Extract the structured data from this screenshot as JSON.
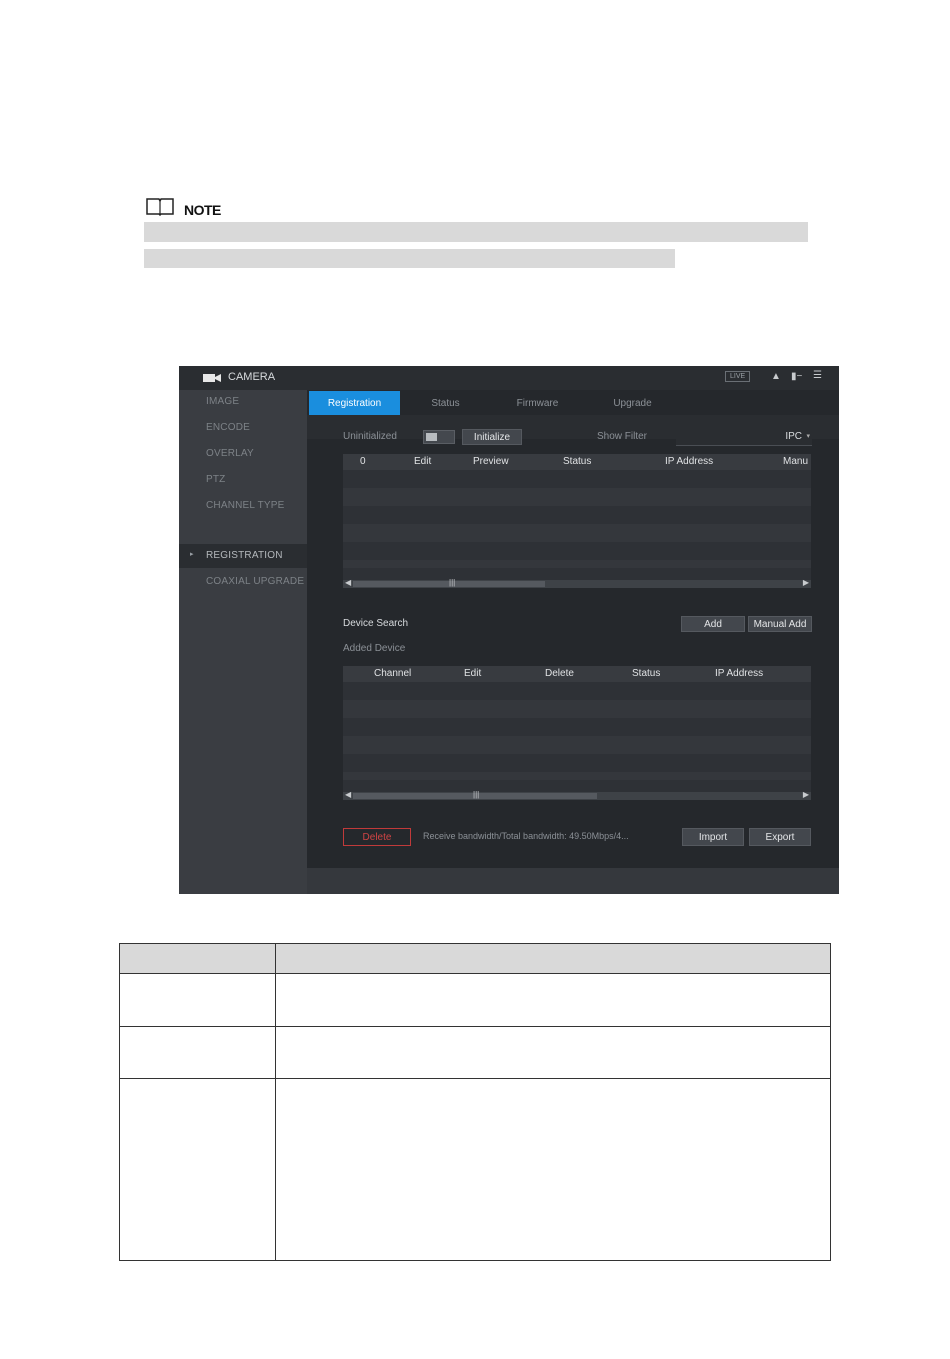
{
  "note": {
    "label": "NOTE",
    "icon": "book-icon"
  },
  "ui": {
    "title": "CAMERA",
    "title_icon": "camera-icon",
    "top_badge": "LIVE",
    "top_icons": [
      "user-icon",
      "monitor-icon",
      "menu-icon"
    ],
    "sidebar": [
      {
        "label": "IMAGE"
      },
      {
        "label": "ENCODE"
      },
      {
        "label": "OVERLAY"
      },
      {
        "label": "PTZ"
      },
      {
        "label": "CHANNEL TYPE"
      },
      {
        "label": "REGISTRATION",
        "active": true
      },
      {
        "label": "COAXIAL UPGRADE"
      }
    ],
    "tabs": [
      "Registration",
      "Status",
      "Firmware",
      "Upgrade"
    ],
    "uninitialized_label": "Uninitialized",
    "initialize_button": "Initialize",
    "show_filter_label": "Show Filter",
    "show_filter_value": "IPC",
    "search_grid_headers": [
      "0",
      "Edit",
      "Preview",
      "Status",
      "IP Address",
      "Manu"
    ],
    "device_search_button": "Device Search",
    "add_button": "Add",
    "manual_add_button": "Manual Add",
    "added_device_label": "Added Device",
    "added_grid_headers": [
      "Channel",
      "Edit",
      "Delete",
      "Status",
      "IP Address"
    ],
    "delete_button": "Delete",
    "bandwidth_text": "Receive bandwidth/Total bandwidth:  49.50Mbps/4...",
    "import_button": "Import",
    "export_button": "Export",
    "accent_color": "#1a8ede"
  }
}
